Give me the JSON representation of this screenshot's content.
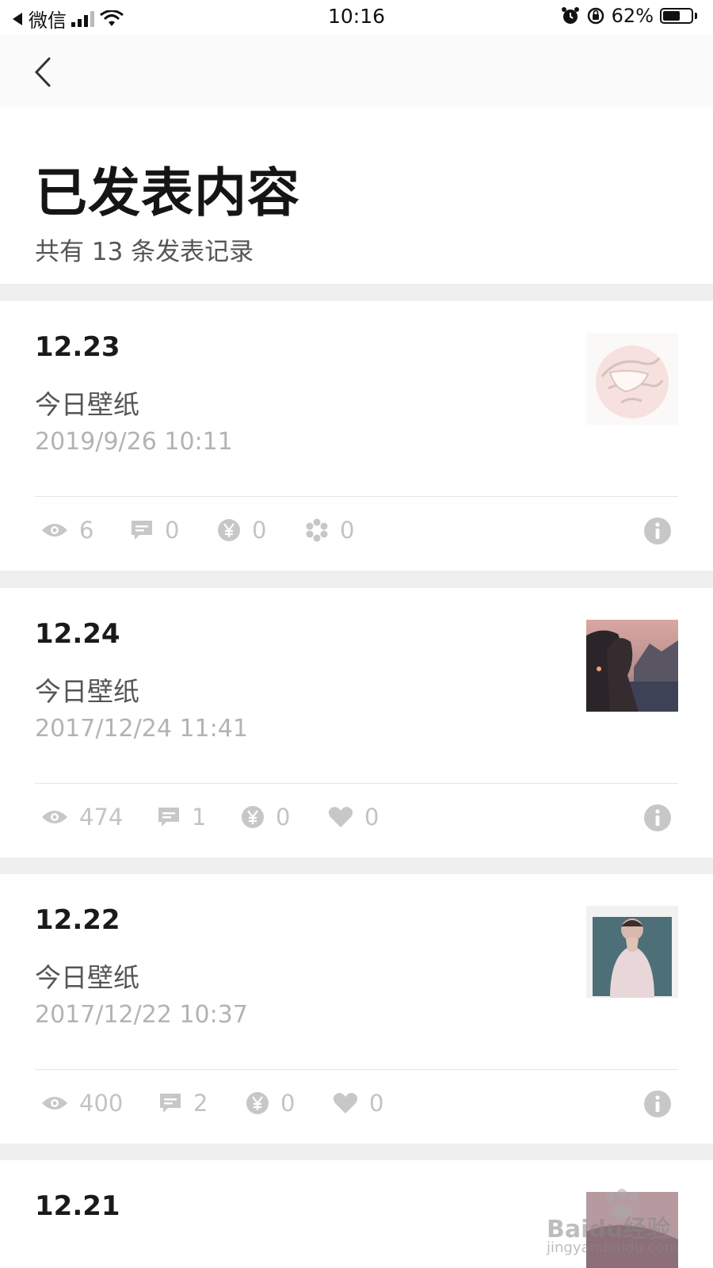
{
  "status_bar": {
    "back_app": "微信",
    "time": "10:16",
    "battery": "62%",
    "battery_level": 0.62
  },
  "header": {
    "title": "已发表内容",
    "subtitle": "共有 13 条发表记录"
  },
  "posts": [
    {
      "title": "12.23",
      "desc": "今日壁纸",
      "time": "2019/9/26  10:11",
      "views": "6",
      "comments": "0",
      "rewards": "0",
      "likes": "0",
      "like_icon": "flower-icon"
    },
    {
      "title": "12.24",
      "desc": "今日壁纸",
      "time": "2017/12/24  11:41",
      "views": "474",
      "comments": "1",
      "rewards": "0",
      "likes": "0",
      "like_icon": "heart-icon"
    },
    {
      "title": "12.22",
      "desc": "今日壁纸",
      "time": "2017/12/22  10:37",
      "views": "400",
      "comments": "2",
      "rewards": "0",
      "likes": "0",
      "like_icon": "heart-icon"
    },
    {
      "title": "12.21"
    }
  ],
  "watermark": {
    "brand": "Baidu经验",
    "url": "jingyan.baidu.com"
  },
  "colors": {
    "background": "#ffffff",
    "divider": "#efefef",
    "muted": "#c3c3c3"
  }
}
